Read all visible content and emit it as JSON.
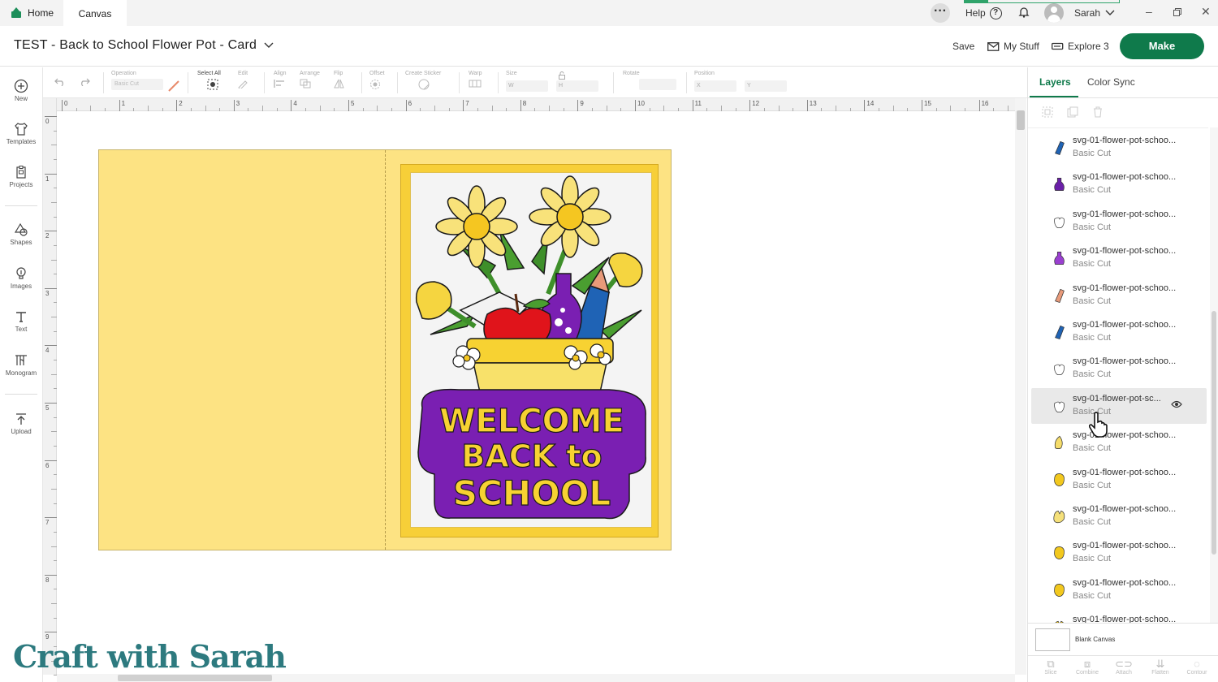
{
  "tabs": {
    "home": "Home",
    "canvas": "Canvas"
  },
  "topbar": {
    "help": "Help",
    "help_icon": "?",
    "user": "Sarah",
    "progress": 0.15
  },
  "header": {
    "title": "TEST - Back to School Flower Pot - Card",
    "save": "Save",
    "my_stuff": "My Stuff",
    "machine": "Explore 3",
    "make": "Make"
  },
  "rail": [
    {
      "label": "New",
      "icon": "plus-circle-icon"
    },
    {
      "label": "Templates",
      "icon": "shirt-icon"
    },
    {
      "label": "Projects",
      "icon": "clipboard-icon"
    },
    {
      "label": "Shapes",
      "icon": "shapes-icon"
    },
    {
      "label": "Images",
      "icon": "lightbulb-icon"
    },
    {
      "label": "Text",
      "icon": "text-icon"
    },
    {
      "label": "Monogram",
      "icon": "monogram-icon"
    },
    {
      "label": "Upload",
      "icon": "upload-icon"
    }
  ],
  "toolbar": {
    "operation_label": "Operation",
    "operation_value": "Basic Cut",
    "select_all": "Select All",
    "edit": "Edit",
    "align": "Align",
    "arrange": "Arrange",
    "flip": "Flip",
    "offset": "Offset",
    "create_sticker": "Create Sticker",
    "warp": "Warp",
    "size": "Size",
    "size_w": "W",
    "size_h": "H",
    "rotate": "Rotate",
    "position": "Position",
    "pos_x": "X",
    "pos_y": "Y"
  },
  "ruler_h": [
    "0",
    "1",
    "2",
    "3",
    "4",
    "5",
    "6",
    "7",
    "8",
    "9",
    "10",
    "11",
    "12",
    "13",
    "14",
    "15",
    "16"
  ],
  "ruler_v": [
    "0",
    "1",
    "2",
    "3",
    "4",
    "5",
    "6",
    "7",
    "8",
    "9"
  ],
  "design": {
    "line1": "WELCOME",
    "line2": "BACK to",
    "line3": "SCHOOL"
  },
  "panel": {
    "tab_layers": "Layers",
    "tab_color_sync": "Color Sync",
    "blank_canvas": "Blank Canvas"
  },
  "layers": [
    {
      "name": "svg-01-flower-pot-schoo...",
      "op": "Basic Cut",
      "color": "#1f63b5",
      "shape": "pencil"
    },
    {
      "name": "svg-01-flower-pot-schoo...",
      "op": "Basic Cut",
      "color": "#6a1fa8",
      "shape": "flask"
    },
    {
      "name": "svg-01-flower-pot-schoo...",
      "op": "Basic Cut",
      "color": "#ffffff",
      "shape": "apple"
    },
    {
      "name": "svg-01-flower-pot-schoo...",
      "op": "Basic Cut",
      "color": "#9a3fd0",
      "shape": "flask"
    },
    {
      "name": "svg-01-flower-pot-schoo...",
      "op": "Basic Cut",
      "color": "#e89a7a",
      "shape": "pencil"
    },
    {
      "name": "svg-01-flower-pot-schoo...",
      "op": "Basic Cut",
      "color": "#1f63b5",
      "shape": "pencil"
    },
    {
      "name": "svg-01-flower-pot-schoo...",
      "op": "Basic Cut",
      "color": "#ffffff",
      "shape": "apple"
    },
    {
      "name": "svg-01-flower-pot-sc...",
      "op": "Basic Cut",
      "color": "#ffffff",
      "shape": "apple",
      "selected": true
    },
    {
      "name": "svg-01-flower-pot-schoo...",
      "op": "Basic Cut",
      "color": "#f5dc6a",
      "shape": "leaf"
    },
    {
      "name": "svg-01-flower-pot-schoo...",
      "op": "Basic Cut",
      "color": "#f2c81e",
      "shape": "blob"
    },
    {
      "name": "svg-01-flower-pot-schoo...",
      "op": "Basic Cut",
      "color": "#f5e07a",
      "shape": "tulip"
    },
    {
      "name": "svg-01-flower-pot-schoo...",
      "op": "Basic Cut",
      "color": "#f2c81e",
      "shape": "blob"
    },
    {
      "name": "svg-01-flower-pot-schoo...",
      "op": "Basic Cut",
      "color": "#f2c81e",
      "shape": "blob"
    },
    {
      "name": "svg-01-flower-pot-schoo...",
      "op": "Basic Cut",
      "color": "#f2c81e",
      "shape": "tulip"
    }
  ],
  "bottom_tools": [
    "Slice",
    "Combine",
    "Attach",
    "Flatten",
    "Contour"
  ],
  "watermark": "Craft with Sarah",
  "colors": {
    "brand": "#0f7a4b",
    "card": "#fde383",
    "frame": "#f7cf38",
    "purple": "#7a1fb2",
    "yellow": "#f7d232"
  }
}
